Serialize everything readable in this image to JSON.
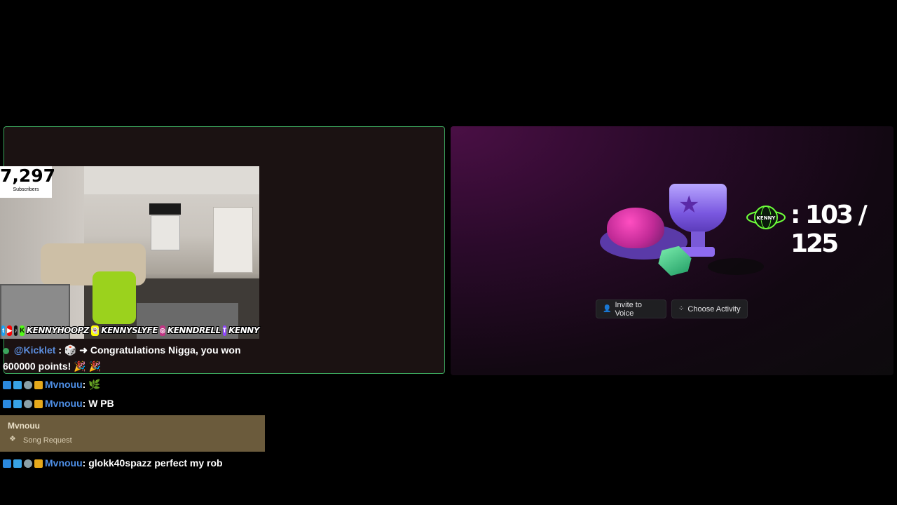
{
  "stream": {
    "subscriber_count": "7,297",
    "subscriber_label": "Subscribers",
    "socials": [
      {
        "icon": "twitter-icon",
        "color": "#1da1f2"
      },
      {
        "icon": "youtube-icon",
        "color": "#ff0000"
      },
      {
        "icon": "tiktok-icon",
        "color": "#111111"
      },
      {
        "icon": "kick-icon",
        "color": "#53fc18"
      }
    ],
    "social_handles": [
      "KENNYHOOPZ",
      "KENNYSLYFE",
      "KENNDRELL",
      "KENNY"
    ]
  },
  "chat": {
    "first": {
      "user": "@Kicklet",
      "message": " : 🎲 ➜ Congratulations Nigga, you won 600000 points! 🎉 🎉"
    },
    "lines": [
      {
        "user": "Mvnouu",
        "message": " : 🌿"
      },
      {
        "user": "Mvnouu",
        "message": " : W PB"
      },
      {
        "user": "Mvnouu",
        "message": " : glokk40spazz perfect my rob"
      }
    ],
    "song_request": {
      "user": "Mvnouu",
      "label": "Song Request"
    }
  },
  "activity": {
    "counter": ": 103 / 125",
    "invite_label": "Invite to Voice",
    "choose_label": "Choose Activity"
  }
}
